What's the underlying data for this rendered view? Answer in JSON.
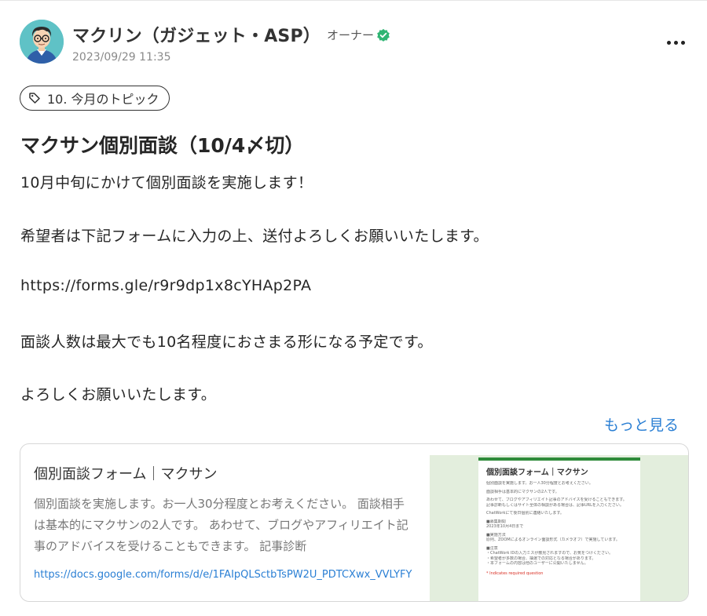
{
  "author": {
    "name": "マクリン（ガジェット・ASP）",
    "role": "オーナー",
    "timestamp": "2023/09/29 11:35"
  },
  "icons": {
    "avatar": "avatar-glasses-man",
    "verified": "check-badge-icon",
    "more": "more-horizontal-icon",
    "tag": "tag-icon"
  },
  "colors": {
    "link": "#2a7fd4",
    "verified": "#2fb573",
    "avatar_bg": "#5fc2c6"
  },
  "topic": {
    "label": "10. 今月のトピック"
  },
  "post": {
    "title": "マクサン個別面談（10/4〆切）",
    "lines": [
      "10月中旬にかけて個別面談を実施します！",
      "希望者は下記フォームに入力の上、送付よろしくお願いいたします。",
      "https://forms.gle/r9r9dp1x8cYHAp2PA",
      "面談人数は最大でも10名程度におさまる形になる予定です。",
      "よろしくお願いいたします。"
    ],
    "see_more": "もっと見る"
  },
  "link_card": {
    "title": "個別面談フォーム｜マクサン",
    "description": "個別面談を実施します。お一人30分程度とお考えください。 面談相手は基本的にマクサンの2人です。 あわせて、ブログやアフィリエイト記事のアドバイスを受けることもできます。 記事診断",
    "url": "https://docs.google.com/forms/d/e/1FAIpQLSctbTsPW2U_PDTCXwx_VVLYFY",
    "thumbnail": {
      "title": "個別面談フォーム｜マクサン",
      "lines": [
        "個別面談を実施します。お一人30分程度とお考えください。",
        "面談相手は基本的にマクサンの2人です。",
        "あわせて、ブログやアフィリエイト記事のアドバイスを受けることもできます。",
        "記事診断もしくはサイト全体の相談がある場合は、記事URLを入力ください。",
        "ChatWorkにて後日個別に連絡いたします。",
        "■募集期間",
        "2023年10月4日まで",
        "■実施方法",
        "原則、ZOOMによるオンライン面談形式（カメラオフ）で実施しています。",
        "■注意",
        "・ChatWork IDの入力ミスが散見されますので、お気をつけください。",
        "・希望者が多数の場合、抽選での対応となる場合があります。",
        "・本フォームの内容は他のユーザーに公開いたしません。"
      ],
      "required": "* Indicates required question"
    }
  }
}
